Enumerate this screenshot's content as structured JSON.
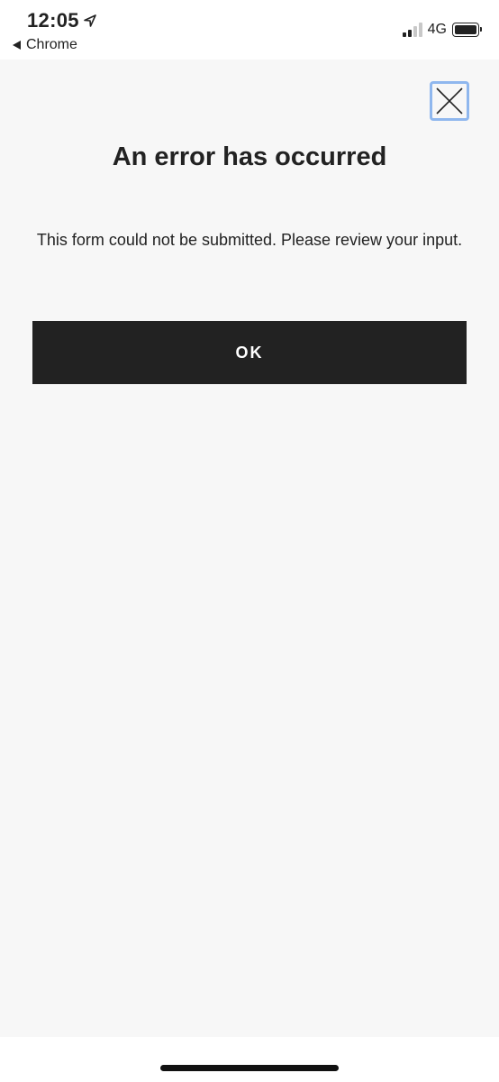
{
  "status_bar": {
    "time": "12:05",
    "back_app": "Chrome",
    "network": "4G",
    "signal_bars_active": 2,
    "signal_bars_total": 4
  },
  "dialog": {
    "title": "An error has occurred",
    "message": "This form could not be submitted. Please review your input.",
    "ok_label": "OK"
  },
  "icons": {
    "close": "close-icon",
    "location": "location-arrow-icon",
    "back": "back-triangle-icon",
    "battery": "battery-icon"
  },
  "colors": {
    "background": "#f7f7f7",
    "button_bg": "#222222",
    "button_text": "#ffffff",
    "focus_ring": "#8fb7ee"
  }
}
